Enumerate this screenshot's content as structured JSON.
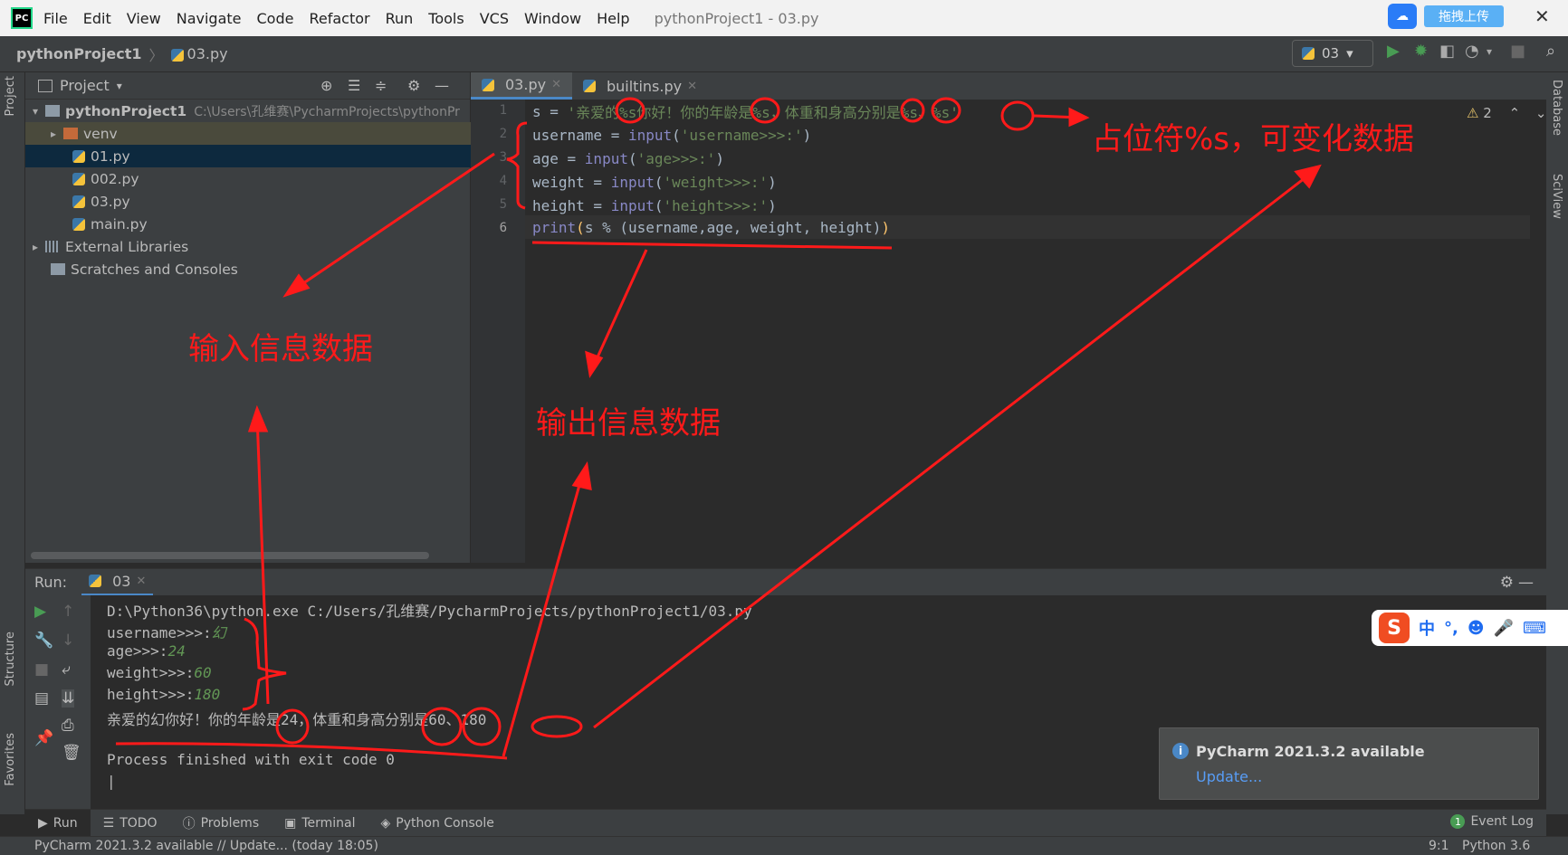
{
  "menubar": {
    "logo": "PC",
    "items": [
      "File",
      "Edit",
      "View",
      "Navigate",
      "Code",
      "Refactor",
      "Run",
      "Tools",
      "VCS",
      "Window",
      "Help"
    ],
    "title": "pythonProject1 - 03.py",
    "upload_button": "拖拽上传"
  },
  "navbar": {
    "project": "pythonProject1",
    "file": "03.py",
    "run_config": "03"
  },
  "project_panel": {
    "title": "Project",
    "root_name": "pythonProject1",
    "root_path": "C:\\Users\\孔维赛\\PycharmProjects\\pythonPr",
    "items": [
      "venv",
      "01.py",
      "002.py",
      "03.py",
      "main.py"
    ],
    "external_libraries": "External Libraries",
    "scratches": "Scratches and Consoles"
  },
  "side_tabs": {
    "project": "Project",
    "structure": "Structure",
    "favorites": "Favorites",
    "database": "Database",
    "sciview": "SciView"
  },
  "editor": {
    "tabs": [
      {
        "label": "03.py",
        "active": true
      },
      {
        "label": "builtins.py",
        "active": false
      }
    ],
    "line_numbers": [
      "1",
      "2",
      "3",
      "4",
      "5",
      "6"
    ],
    "warning_count": "2",
    "line1": {
      "var": "s = ",
      "str": "'亲爱的%s你好！你的年龄是%s，体重和身高分别是%s、%s'"
    },
    "line2": {
      "var": "username = ",
      "fn": "input",
      "open": "(",
      "str": "'username>>>:'",
      "close": ")"
    },
    "line3": {
      "var": "age = ",
      "fn": "input",
      "open": "(",
      "str": "'age>>>:'",
      "close": ")"
    },
    "line4": {
      "var": "weight = ",
      "fn": "input",
      "open": "(",
      "str": "'weight>>>:'",
      "close": ")"
    },
    "line5": {
      "var": "height = ",
      "fn": "input",
      "open": "(",
      "str": "'height>>>:'",
      "close": ")"
    },
    "line6": {
      "fn": "print",
      "open": "(",
      "body": "s % (username,age, weight, height)",
      "close": ")"
    }
  },
  "run_panel": {
    "label": "Run:",
    "tab": "03",
    "cmd": "D:\\Python36\\python.exe C:/Users/孔维赛/PycharmProjects/pythonProject1/03.py",
    "lines": [
      {
        "prompt": "username>>>:",
        "input": "幻"
      },
      {
        "prompt": "age>>>:",
        "input": "24"
      },
      {
        "prompt": "weight>>>:",
        "input": "60"
      },
      {
        "prompt": "height>>>:",
        "input": "180"
      }
    ],
    "result": "亲爱的幻你好！你的年龄是24，体重和身高分别是60、180",
    "exit": "Process finished with exit code 0"
  },
  "ime": {
    "mode": "中",
    "punct": "°,"
  },
  "notification": {
    "title": "PyCharm 2021.3.2 available",
    "link": "Update..."
  },
  "bottom_tabs": [
    "Run",
    "TODO",
    "Problems",
    "Terminal",
    "Python Console"
  ],
  "event_log": "Event Log",
  "status": {
    "message": "PyCharm 2021.3.2 available // Update... (today 18:05)",
    "position": "9:1",
    "interpreter": "Python 3.6"
  },
  "annotations": {
    "placeholder": "占位符%s，可变化数据",
    "input_info": "输入信息数据",
    "output_info": "输出信息数据"
  },
  "colors": {
    "annotation": "#ff1a1a",
    "keyword": "#cc7832",
    "string": "#6a8759",
    "builtin": "#8888c6",
    "selection": "#0d293e"
  }
}
